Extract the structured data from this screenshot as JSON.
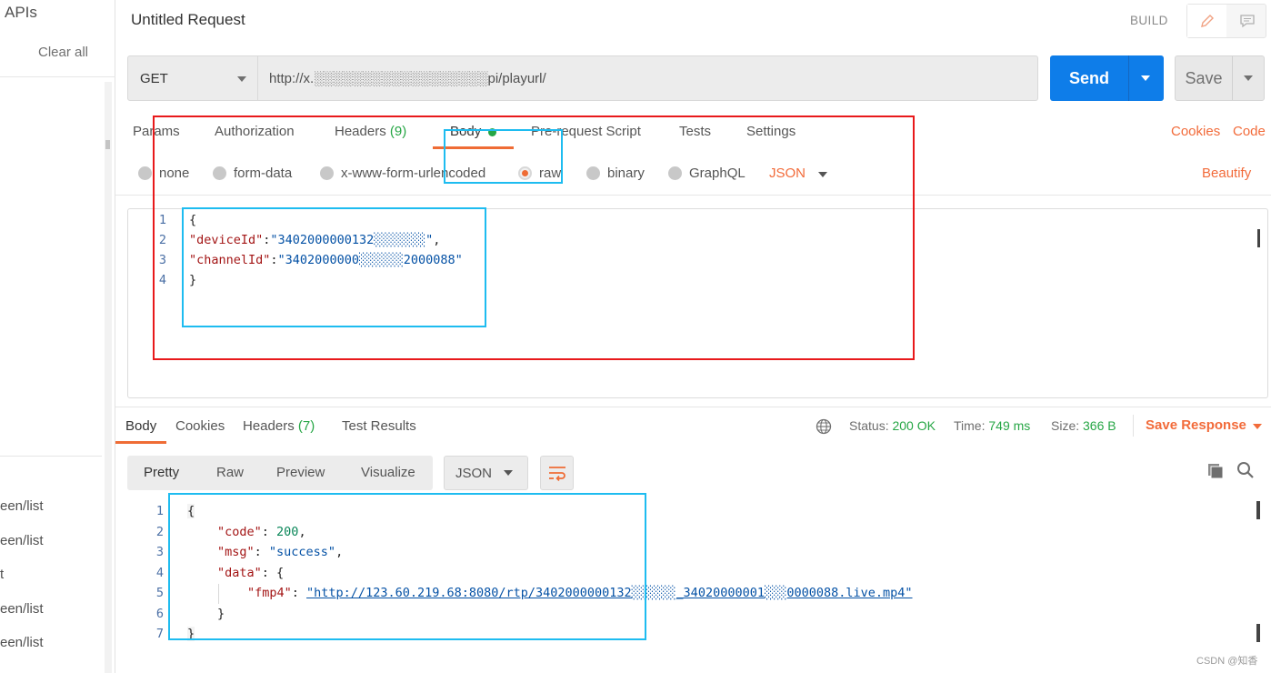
{
  "sidebar": {
    "title": "APIs",
    "clear_all": "Clear all",
    "history": [
      "een/list",
      "een/list",
      "t",
      "een/list",
      "een/list"
    ]
  },
  "header": {
    "title": "Untitled Request",
    "build_label": "BUILD"
  },
  "request": {
    "method": "GET",
    "url": "http://x.░░░░░░░░░░░░░░░░░░pi/playurl/",
    "send_label": "Send",
    "save_label": "Save",
    "tabs": {
      "params": "Params",
      "authorization": "Authorization",
      "headers": "Headers",
      "headers_count": "(9)",
      "body": "Body",
      "prerequest": "Pre-request Script",
      "tests": "Tests",
      "settings": "Settings"
    },
    "cookies_link": "Cookies",
    "code_link": "Code",
    "body_types": {
      "none": "none",
      "form_data": "form-data",
      "urlencoded": "x-www-form-urlencoded",
      "raw": "raw",
      "binary": "binary",
      "graphql": "GraphQL",
      "format": "JSON",
      "selected": "raw"
    },
    "beautify_link": "Beautify",
    "body_lines": {
      "l1": "{",
      "deviceId_key": "\"deviceId\"",
      "deviceId_val": "\"3402000000132░░░░░░░\"",
      "channelId_key": "\"channelId\"",
      "channelId_val": "\"3402000000░░░░░░2000088\"",
      "l4": "}"
    }
  },
  "response": {
    "tabs": {
      "body": "Body",
      "cookies": "Cookies",
      "headers": "Headers",
      "headers_count": "(7)",
      "test_results": "Test Results"
    },
    "status_label": "Status:",
    "status_value": "200 OK",
    "time_label": "Time:",
    "time_value": "749 ms",
    "size_label": "Size:",
    "size_value": "366 B",
    "save_response": "Save Response",
    "format_tabs": {
      "pretty": "Pretty",
      "raw": "Raw",
      "preview": "Preview",
      "visualize": "Visualize"
    },
    "format": "JSON",
    "body_lines": {
      "open": "{",
      "code_key": "\"code\"",
      "code_val": "200",
      "msg_key": "\"msg\"",
      "msg_val": "\"success\"",
      "data_key": "\"data\"",
      "fmp4_key": "\"fmp4\"",
      "fmp4_val": "\"http://123.60.219.68:8080/rtp/3402000000132░░░░░░_34020000001░░░0000088.live.mp4\"",
      "data_close": "}",
      "close": "}"
    }
  },
  "watermark": "CSDN @知香",
  "colors": {
    "accent": "#ef6c35",
    "send": "#0e7de9",
    "success": "#26a645",
    "annotation_red": "#e8191b",
    "annotation_blue": "#1ebcf0"
  },
  "icons": [
    "pencil-icon",
    "comment-icon",
    "chevron-down-icon",
    "globe-icon",
    "wrap-lines-icon",
    "copy-icon",
    "search-icon"
  ]
}
